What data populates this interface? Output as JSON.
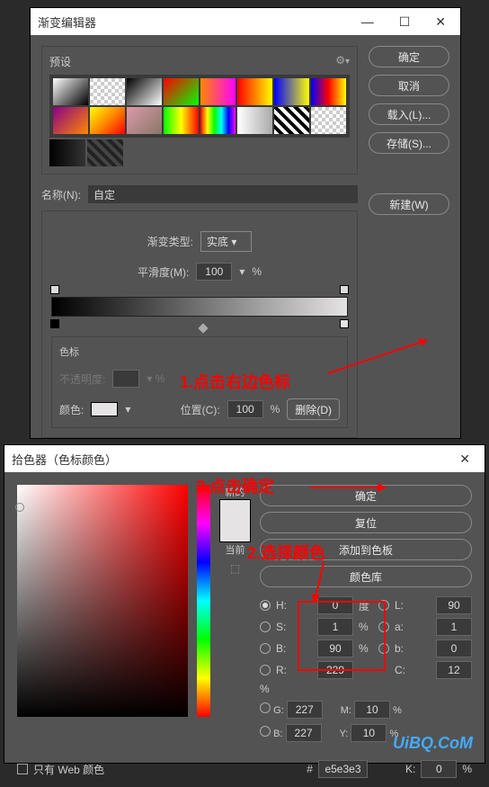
{
  "gradient_editor": {
    "title": "渐变编辑器",
    "presets_label": "预设",
    "name_label": "名称(N):",
    "name_value": "自定",
    "type_label": "渐变类型:",
    "type_value": "实底",
    "smooth_label": "平滑度(M):",
    "smooth_value": "100",
    "percent": "%",
    "stops_label": "色标",
    "opacity_label": "不透明度:",
    "position_label": "位置(C):",
    "position_value": "100",
    "color_label": "颜色:",
    "delete_label": "删除(D)",
    "buttons": {
      "ok": "确定",
      "cancel": "取消",
      "load": "载入(L)...",
      "save": "存储(S)...",
      "new": "新建(W)"
    }
  },
  "color_picker": {
    "title": "拾色器（色标颜色）",
    "new_label": "新的",
    "current_label": "当前",
    "web_only": "只有 Web 颜色",
    "buttons": {
      "ok": "确定",
      "reset": "复位",
      "add_swatch": "添加到色板",
      "library": "颜色库"
    },
    "fields": {
      "H": {
        "label": "H:",
        "value": "0",
        "unit": "度"
      },
      "S": {
        "label": "S:",
        "value": "1",
        "unit": "%"
      },
      "B": {
        "label": "B:",
        "value": "90",
        "unit": "%"
      },
      "R": {
        "label": "R:",
        "value": "229"
      },
      "G": {
        "label": "G:",
        "value": "227"
      },
      "Bb": {
        "label": "B:",
        "value": "227"
      },
      "L": {
        "label": "L:",
        "value": "90"
      },
      "a": {
        "label": "a:",
        "value": "1"
      },
      "b2": {
        "label": "b:",
        "value": "0"
      },
      "C": {
        "label": "C:",
        "value": "12",
        "unit": "%"
      },
      "M": {
        "label": "M:",
        "value": "10",
        "unit": "%"
      },
      "Y": {
        "label": "Y:",
        "value": "10",
        "unit": "%"
      },
      "K": {
        "label": "K:",
        "value": "0",
        "unit": "%"
      },
      "hex": {
        "label": "#",
        "value": "e5e3e3"
      }
    }
  },
  "annotations": {
    "step1": "1.点击右边色标",
    "step2": "2.选择颜色",
    "step3": "3.点击确定"
  },
  "watermark": "UiBQ.CoM"
}
